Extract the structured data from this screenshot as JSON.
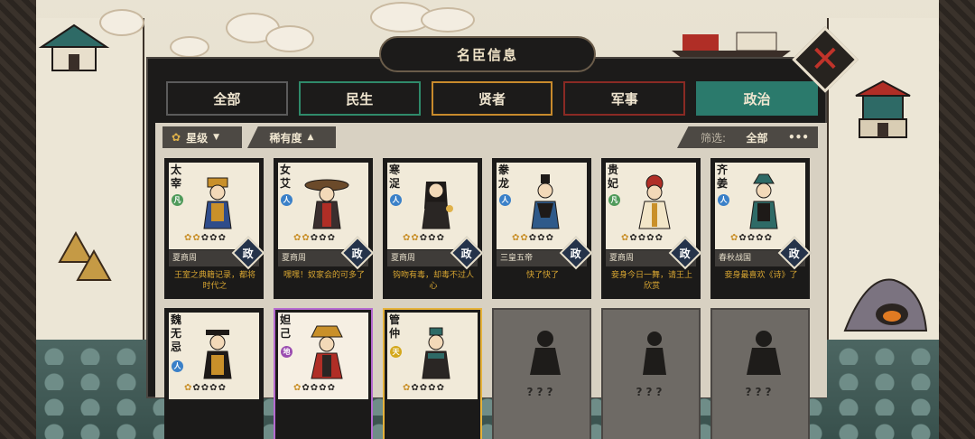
{
  "window": {
    "title": "名臣信息"
  },
  "close_label": "✕",
  "tabs": [
    {
      "label": "全部",
      "active": false
    },
    {
      "label": "民生",
      "active": false
    },
    {
      "label": "贤者",
      "active": false
    },
    {
      "label": "军事",
      "active": false
    },
    {
      "label": "政治",
      "active": true
    }
  ],
  "filters": {
    "star": "星级",
    "rarity": "稀有度",
    "screen_label": "筛选:",
    "screen_value": "全部",
    "more": "•••"
  },
  "cards": [
    {
      "name": "太宰",
      "badge": "凡",
      "stars": 2,
      "era": "夏商周",
      "class": "政",
      "quote": "王室之典籍记录，都将时代之"
    },
    {
      "name": "女艾",
      "badge": "人",
      "stars": 2,
      "era": "夏商周",
      "class": "政",
      "quote": "嘿嘿！奴家会的可多了"
    },
    {
      "name": "寒浞",
      "badge": "人",
      "stars": 2,
      "era": "夏商周",
      "class": "政",
      "quote": "钩吻有毒，却毒不过人心"
    },
    {
      "name": "豢龙",
      "badge": "人",
      "stars": 2,
      "era": "三皇五帝",
      "class": "政",
      "quote": "快了快了"
    },
    {
      "name": "贵妃",
      "badge": "凡",
      "stars": 1,
      "era": "夏商周",
      "class": "政",
      "quote": "妾身今日一舞，请王上欣赏"
    },
    {
      "name": "齐姜",
      "badge": "人",
      "stars": 1,
      "era": "春秋战国",
      "class": "政",
      "quote": "妾身最喜欢《诗》了"
    },
    {
      "name": "魏无忌",
      "badge": "人",
      "stars": 1
    },
    {
      "name": "妲己",
      "badge": "地",
      "stars": 1
    },
    {
      "name": "管仲",
      "badge": "天",
      "stars": 1
    },
    {
      "locked": true,
      "mystery": "???"
    },
    {
      "locked": true,
      "mystery": "???"
    },
    {
      "locked": true,
      "mystery": "???"
    }
  ],
  "colors": {
    "accent": "#2b7a6c",
    "star": "#c9902a",
    "quote": "#d6a431"
  }
}
